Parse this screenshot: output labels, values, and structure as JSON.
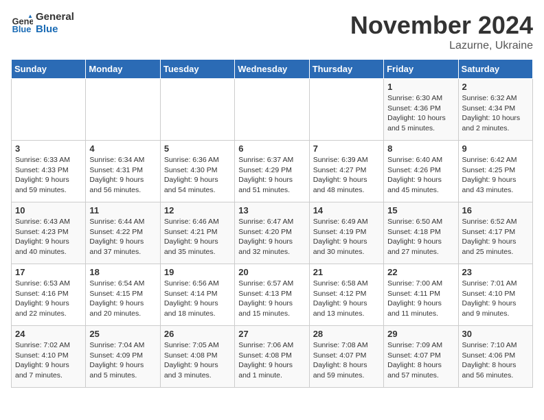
{
  "logo": {
    "text_general": "General",
    "text_blue": "Blue"
  },
  "title": "November 2024",
  "location": "Lazurne, Ukraine",
  "days_of_week": [
    "Sunday",
    "Monday",
    "Tuesday",
    "Wednesday",
    "Thursday",
    "Friday",
    "Saturday"
  ],
  "weeks": [
    [
      {
        "num": "",
        "info": ""
      },
      {
        "num": "",
        "info": ""
      },
      {
        "num": "",
        "info": ""
      },
      {
        "num": "",
        "info": ""
      },
      {
        "num": "",
        "info": ""
      },
      {
        "num": "1",
        "info": "Sunrise: 6:30 AM\nSunset: 4:36 PM\nDaylight: 10 hours\nand 5 minutes."
      },
      {
        "num": "2",
        "info": "Sunrise: 6:32 AM\nSunset: 4:34 PM\nDaylight: 10 hours\nand 2 minutes."
      }
    ],
    [
      {
        "num": "3",
        "info": "Sunrise: 6:33 AM\nSunset: 4:33 PM\nDaylight: 9 hours\nand 59 minutes."
      },
      {
        "num": "4",
        "info": "Sunrise: 6:34 AM\nSunset: 4:31 PM\nDaylight: 9 hours\nand 56 minutes."
      },
      {
        "num": "5",
        "info": "Sunrise: 6:36 AM\nSunset: 4:30 PM\nDaylight: 9 hours\nand 54 minutes."
      },
      {
        "num": "6",
        "info": "Sunrise: 6:37 AM\nSunset: 4:29 PM\nDaylight: 9 hours\nand 51 minutes."
      },
      {
        "num": "7",
        "info": "Sunrise: 6:39 AM\nSunset: 4:27 PM\nDaylight: 9 hours\nand 48 minutes."
      },
      {
        "num": "8",
        "info": "Sunrise: 6:40 AM\nSunset: 4:26 PM\nDaylight: 9 hours\nand 45 minutes."
      },
      {
        "num": "9",
        "info": "Sunrise: 6:42 AM\nSunset: 4:25 PM\nDaylight: 9 hours\nand 43 minutes."
      }
    ],
    [
      {
        "num": "10",
        "info": "Sunrise: 6:43 AM\nSunset: 4:23 PM\nDaylight: 9 hours\nand 40 minutes."
      },
      {
        "num": "11",
        "info": "Sunrise: 6:44 AM\nSunset: 4:22 PM\nDaylight: 9 hours\nand 37 minutes."
      },
      {
        "num": "12",
        "info": "Sunrise: 6:46 AM\nSunset: 4:21 PM\nDaylight: 9 hours\nand 35 minutes."
      },
      {
        "num": "13",
        "info": "Sunrise: 6:47 AM\nSunset: 4:20 PM\nDaylight: 9 hours\nand 32 minutes."
      },
      {
        "num": "14",
        "info": "Sunrise: 6:49 AM\nSunset: 4:19 PM\nDaylight: 9 hours\nand 30 minutes."
      },
      {
        "num": "15",
        "info": "Sunrise: 6:50 AM\nSunset: 4:18 PM\nDaylight: 9 hours\nand 27 minutes."
      },
      {
        "num": "16",
        "info": "Sunrise: 6:52 AM\nSunset: 4:17 PM\nDaylight: 9 hours\nand 25 minutes."
      }
    ],
    [
      {
        "num": "17",
        "info": "Sunrise: 6:53 AM\nSunset: 4:16 PM\nDaylight: 9 hours\nand 22 minutes."
      },
      {
        "num": "18",
        "info": "Sunrise: 6:54 AM\nSunset: 4:15 PM\nDaylight: 9 hours\nand 20 minutes."
      },
      {
        "num": "19",
        "info": "Sunrise: 6:56 AM\nSunset: 4:14 PM\nDaylight: 9 hours\nand 18 minutes."
      },
      {
        "num": "20",
        "info": "Sunrise: 6:57 AM\nSunset: 4:13 PM\nDaylight: 9 hours\nand 15 minutes."
      },
      {
        "num": "21",
        "info": "Sunrise: 6:58 AM\nSunset: 4:12 PM\nDaylight: 9 hours\nand 13 minutes."
      },
      {
        "num": "22",
        "info": "Sunrise: 7:00 AM\nSunset: 4:11 PM\nDaylight: 9 hours\nand 11 minutes."
      },
      {
        "num": "23",
        "info": "Sunrise: 7:01 AM\nSunset: 4:10 PM\nDaylight: 9 hours\nand 9 minutes."
      }
    ],
    [
      {
        "num": "24",
        "info": "Sunrise: 7:02 AM\nSunset: 4:10 PM\nDaylight: 9 hours\nand 7 minutes."
      },
      {
        "num": "25",
        "info": "Sunrise: 7:04 AM\nSunset: 4:09 PM\nDaylight: 9 hours\nand 5 minutes."
      },
      {
        "num": "26",
        "info": "Sunrise: 7:05 AM\nSunset: 4:08 PM\nDaylight: 9 hours\nand 3 minutes."
      },
      {
        "num": "27",
        "info": "Sunrise: 7:06 AM\nSunset: 4:08 PM\nDaylight: 9 hours\nand 1 minute."
      },
      {
        "num": "28",
        "info": "Sunrise: 7:08 AM\nSunset: 4:07 PM\nDaylight: 8 hours\nand 59 minutes."
      },
      {
        "num": "29",
        "info": "Sunrise: 7:09 AM\nSunset: 4:07 PM\nDaylight: 8 hours\nand 57 minutes."
      },
      {
        "num": "30",
        "info": "Sunrise: 7:10 AM\nSunset: 4:06 PM\nDaylight: 8 hours\nand 56 minutes."
      }
    ]
  ]
}
